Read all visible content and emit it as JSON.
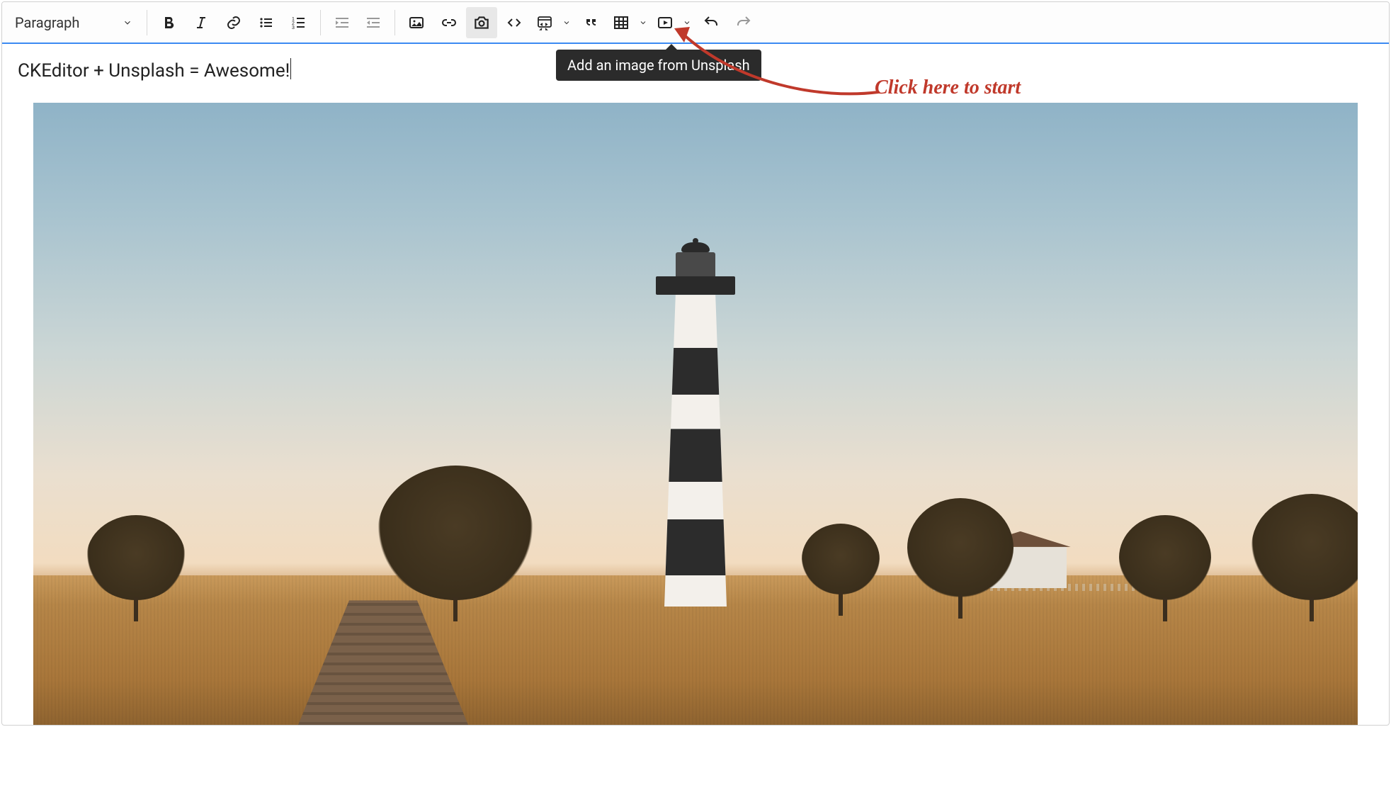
{
  "toolbar": {
    "block_style": "Paragraph",
    "tooltip_unsplash": "Add an image from Unsplash"
  },
  "annotation": {
    "text": "Click here to start"
  },
  "content": {
    "line1": "CKEditor + Unsplash = Awesome!"
  }
}
